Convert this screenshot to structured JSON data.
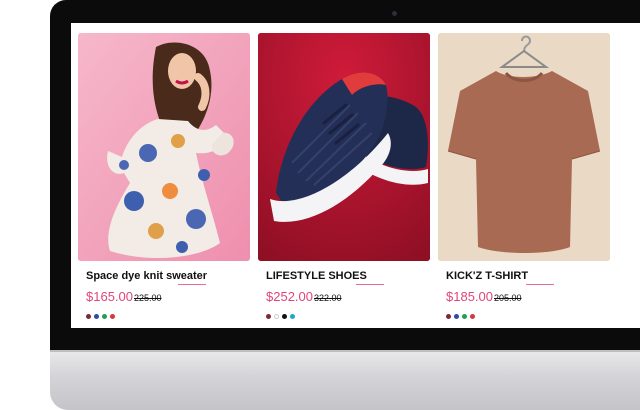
{
  "products": [
    {
      "title": "Space dye knit sweater",
      "price": "$165.00",
      "old_price": "225.00",
      "swatch_colors": [
        "#7a2a3a",
        "#2f4aa0",
        "#1f9d55",
        "#d23b3b"
      ]
    },
    {
      "title": "LIFESTYLE SHOES",
      "price": "$252.00",
      "old_price": "322.00",
      "swatch_colors": [
        "#7a2a3a",
        "#ffffff",
        "#111111",
        "#1fa7c9"
      ]
    },
    {
      "title": "KICK'Z T-SHIRT",
      "price": "$185.00",
      "old_price": "205.00",
      "swatch_colors": [
        "#7a2a3a",
        "#2f4aa0",
        "#1f9d55",
        "#d23b3b"
      ]
    }
  ],
  "colors": {
    "accent_pink": "#e0457b",
    "card1_bg": "#f2a3bb",
    "card2_bg": "#b8142f",
    "card3_bg": "#e8d8c3"
  }
}
